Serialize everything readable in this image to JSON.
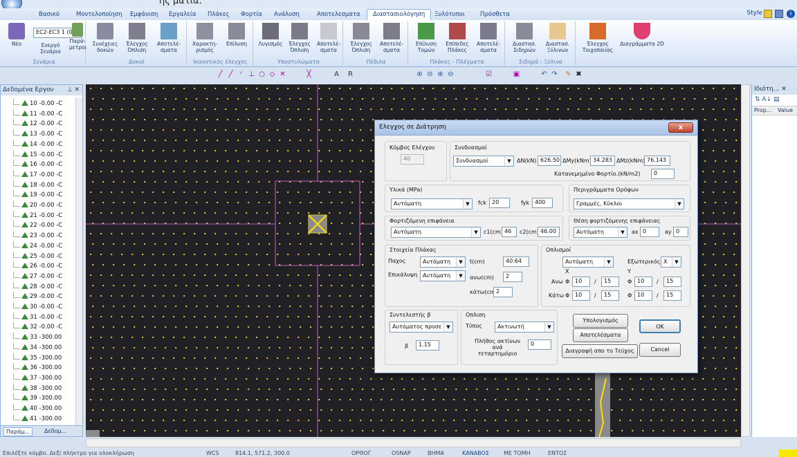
{
  "titlebar": {
    "title": "ής ματιά."
  },
  "tabs": [
    "Βασικό",
    "Μοντελοποίηση",
    "Εμφάνιση",
    "Εργαλεία",
    "Πλάκες",
    "Φορτία",
    "Ανάλυση",
    "Αποτελεσματα",
    "Διαστασιολόγηση",
    "Ξυλότυποι",
    "Πρόσθετα"
  ],
  "active_tab": "Διαστασιολόγηση",
  "style_menu": "Style",
  "ribbon": {
    "scenario_select": "EC2-EC3 1 (0)",
    "groups": [
      {
        "label": "Σενάρια",
        "buttons": [
          "Νέο",
          "Ενεργό Σενάριο",
          "Παρά- μετροι"
        ]
      },
      {
        "label": "Δοκοί",
        "buttons": [
          "Συνέχειες δοκών",
          "Έλεγχος Όπλιση",
          "Αποτελέ- σματα"
        ]
      },
      {
        "label": "Ικανοτικός έλεγχος",
        "buttons": [
          "Χαρακτη- ρισμός",
          "Επίλυση"
        ]
      },
      {
        "label": "Υποστυλώματα",
        "buttons": [
          "Λυγισμός",
          "Έλεγχος Όπλιση",
          "Αποτελέ- σματα"
        ]
      },
      {
        "label": "Πέδιλα",
        "buttons": [
          "Έλεγχος Όπλιση",
          "Αποτελέ- σματα"
        ]
      },
      {
        "label": "Πλάκες - Πλέγματα",
        "buttons": [
          "Επίλυση Τομών",
          "Επίπεδες Πλάκες",
          "Αποτελέ- σματα"
        ]
      },
      {
        "label": "Σιδηρά - Ξύλινα",
        "buttons": [
          "Διαστασ. Σιδηρών",
          "Διαστασ. Ξύλινων"
        ]
      },
      {
        "label": "",
        "buttons": [
          "Έλεγχος Τοιχοποιίας",
          "Διαγράμματα 2D"
        ]
      }
    ]
  },
  "left_panel": {
    "title": "Δεδομένα Εργου",
    "items": [
      "10 -0.00 -C",
      "11 -0.00 -C",
      "12 -0.00 -C",
      "13 -0.00 -C",
      "14 -0.00 -C",
      "15 -0.00 -C",
      "16 -0.00 -C",
      "17 -0.00 -C",
      "18 -0.00 -C",
      "19 -0.00 -C",
      "20 -0.00 -C",
      "21 -0.00 -C",
      "22 -0.00 -C",
      "23 -0.00 -C",
      "24 -0.00 -C",
      "25 -0.00 -C",
      "26 -0.00 -C",
      "27 -0.00 -C",
      "28 -0.00 -C",
      "29 -0.00 -C",
      "30 -0.00 -C",
      "31 -0.00 -C",
      "32 -0.00 -C",
      "33 -300.00",
      "34 -300.00",
      "35 -300.00",
      "36 -300.00",
      "37 -300.00",
      "38 -300.00",
      "39 -300.00",
      "40 -300.00",
      "41 -300.00"
    ],
    "bottom_tabs": [
      "Παράμ...",
      "Δεδομ..."
    ]
  },
  "right_panel": {
    "title": "Ιδιότη...",
    "col_prop": "Prop...",
    "col_value": "Value"
  },
  "status": {
    "hint": "Επιλέξτε κόμβο. Δεξί πλήκτρο για ολοκλήρωση",
    "wcs": "WCS",
    "coords": "814.1, 571.2, 300.0",
    "modes": [
      "ΟΡΘΟΓ",
      "OSNAP",
      "ΒΗΜΑ",
      "ΚΑΝΑΒΟΣ",
      "ΜΕ ΤΟΜΗ",
      "ΕΝΤΟΣ"
    ],
    "active_mode": "ΚΑΝΑΒΟΣ"
  },
  "dialog": {
    "title": "Ελεγχος σε Διάτρηση",
    "close": "x",
    "node": {
      "label": "Κόμβος Ελέγχου",
      "value": "40"
    },
    "combos": {
      "label": "Συνδυασμοί",
      "select": "Συνδυασμοί",
      "dN_label": "ΔΝ(kN)",
      "dN": "626.50",
      "dMy_label": "ΔMy(kNm)",
      "dMy": "34.283",
      "dMz_label": "ΔMz(kNm)",
      "dMz": "76.143",
      "dist_label": "Κατανεμημένο Φορτίο.(kN/m2)",
      "dist": "0"
    },
    "materials": {
      "label": "Υλικά (MPa)",
      "select": "Αυτόματη",
      "fck_label": "fck",
      "fck": "20",
      "fyk_label": "fyk",
      "fyk": "400"
    },
    "outline": {
      "label": "Περιγράμματα Ορόφων",
      "select": "Γραμμές, Κύκλοι"
    },
    "loaded": {
      "label": "Φορτιζόμενη επιφάνεια",
      "select": "Αυτόματη",
      "c1_label": "c1(cm)",
      "c1": "46",
      "c2_label": "c2(cm)",
      "c2": "46.00"
    },
    "position": {
      "label": "Θέση φορτιζόμενης επιφάνειας",
      "select": "Αυτόματη",
      "ax_label": "ax",
      "ax": "0",
      "ay_label": "ay",
      "ay": "0"
    },
    "slab": {
      "label": "Στοιχεία Πλάκας",
      "thick_label": "Παχος",
      "thick_sel": "Αυτόματη",
      "t_label": "t(cm)",
      "t": "40.64",
      "cover_label": "Επικάλυψη",
      "cover_sel": "Αυτόματη",
      "up_label": "ανω(cm)",
      "up": "2",
      "down_label": "κάτω(cm)",
      "down": "2"
    },
    "rebar": {
      "label": "Οπλισμοί",
      "select": "Αυτόματη",
      "ext_label": "Εξωτερικός",
      "ext": "X",
      "x": "X",
      "y": "Y",
      "top_label": "Ανω",
      "bot_label": "Κάτω",
      "phi": "Φ",
      "slash": "/",
      "top_x_d": "10",
      "top_x_s": "15",
      "top_y_d": "10",
      "top_y_s": "15",
      "bot_x_d": "10",
      "bot_x_s": "15",
      "bot_y_d": "10",
      "bot_y_s": "15"
    },
    "beta": {
      "label": "Συντελεστής β",
      "select": "Αυτόματος προσε",
      "b_label": "β",
      "b": "1.15"
    },
    "reinf": {
      "label": "Οπλιση",
      "type_label": "Τύπος",
      "type": "Ακτινωτή",
      "count_label": "Πλήθος ακτίνων ανά τεταρτημόριο",
      "count": "0"
    },
    "buttons": {
      "calc": "Υπολογισμός",
      "results": "Αποτελέσματα",
      "delete": "Διαγραφή απο το Τεύχος",
      "ok": "OK",
      "cancel": "Cancel"
    }
  }
}
